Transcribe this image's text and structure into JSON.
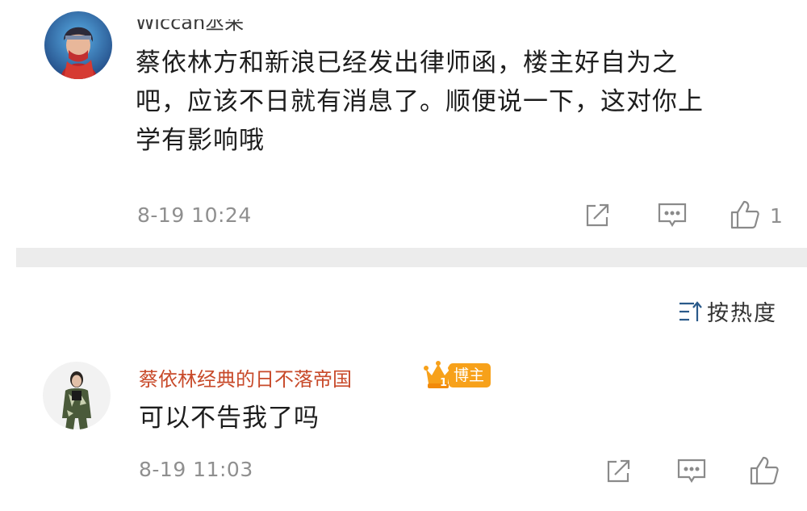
{
  "comments": [
    {
      "username": "Wiccan丞采",
      "text": "蔡依林方和新浪已经发出律师函，楼主好自为之吧，应该不日就有消息了。顺便说一下，这对你上学有影响哦",
      "text_lines": [
        "蔡依林方和新浪已经发出律师函，楼主好自为之",
        "吧，应该不日就有消息了。顺便说一下，这对你上",
        "学有影响哦"
      ],
      "time": "8-19 10:24",
      "like_count": "1"
    },
    {
      "username": "蔡依林经典的日不落帝国",
      "badge_level": "1",
      "badge_label": "博主",
      "text": "可以不告我了吗",
      "time": "8-19 11:03",
      "like_count": ""
    }
  ],
  "sort": {
    "label": "按热度",
    "icon": "sort-icon"
  },
  "icons": {
    "share": "share-icon",
    "comment": "comment-icon",
    "like": "like-icon",
    "badge": "crown-icon"
  },
  "colors": {
    "background": "#ffffff",
    "divider": "#ececec",
    "meta_text": "#8f8f8f",
    "badge": "#f7a11a"
  }
}
